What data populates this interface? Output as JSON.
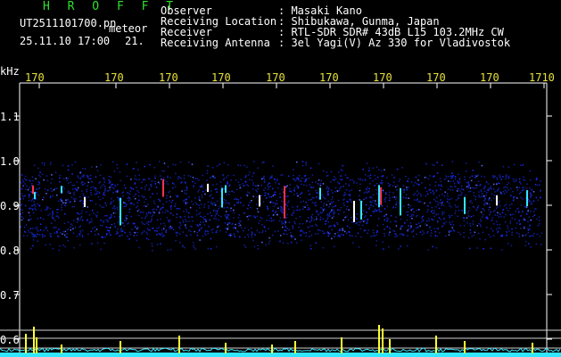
{
  "header": {
    "app_name": "H R O F F T",
    "filename": "UT2511101700.pn",
    "meteor_label": "meteor",
    "datetime": "25.11.10 17:00",
    "count": "21.",
    "info": [
      {
        "key": "Observer",
        "value": ": Masaki Kano"
      },
      {
        "key": "Receiving Location",
        "value": ": Shibukawa, Gunma, Japan"
      },
      {
        "key": "Receiver",
        "value": ": RTL-SDR SDR# 43dB L15 103.2MHz CW"
      },
      {
        "key": "Receiving Antenna",
        "value": ": 3el Yagi(V) Az 330 for Vladivostok"
      }
    ]
  },
  "axes": {
    "y_unit": "kHz",
    "y_labels": [
      "1.1",
      "1.0",
      "0.9",
      "0.8",
      "0.7",
      "0.6"
    ],
    "x_ticks": [
      "170",
      "170",
      "170",
      "170",
      "170",
      "170",
      "170",
      "170",
      "170",
      "1710"
    ]
  },
  "colors": {
    "background": "#000000",
    "header_text": "#ffffff",
    "title_green": "#2ee02e",
    "tick_yellow": "#e8e23a",
    "noise_blue": "#1a2bff",
    "trace_cyan": "#33e6ff",
    "grid_white": "#ffffff"
  }
}
